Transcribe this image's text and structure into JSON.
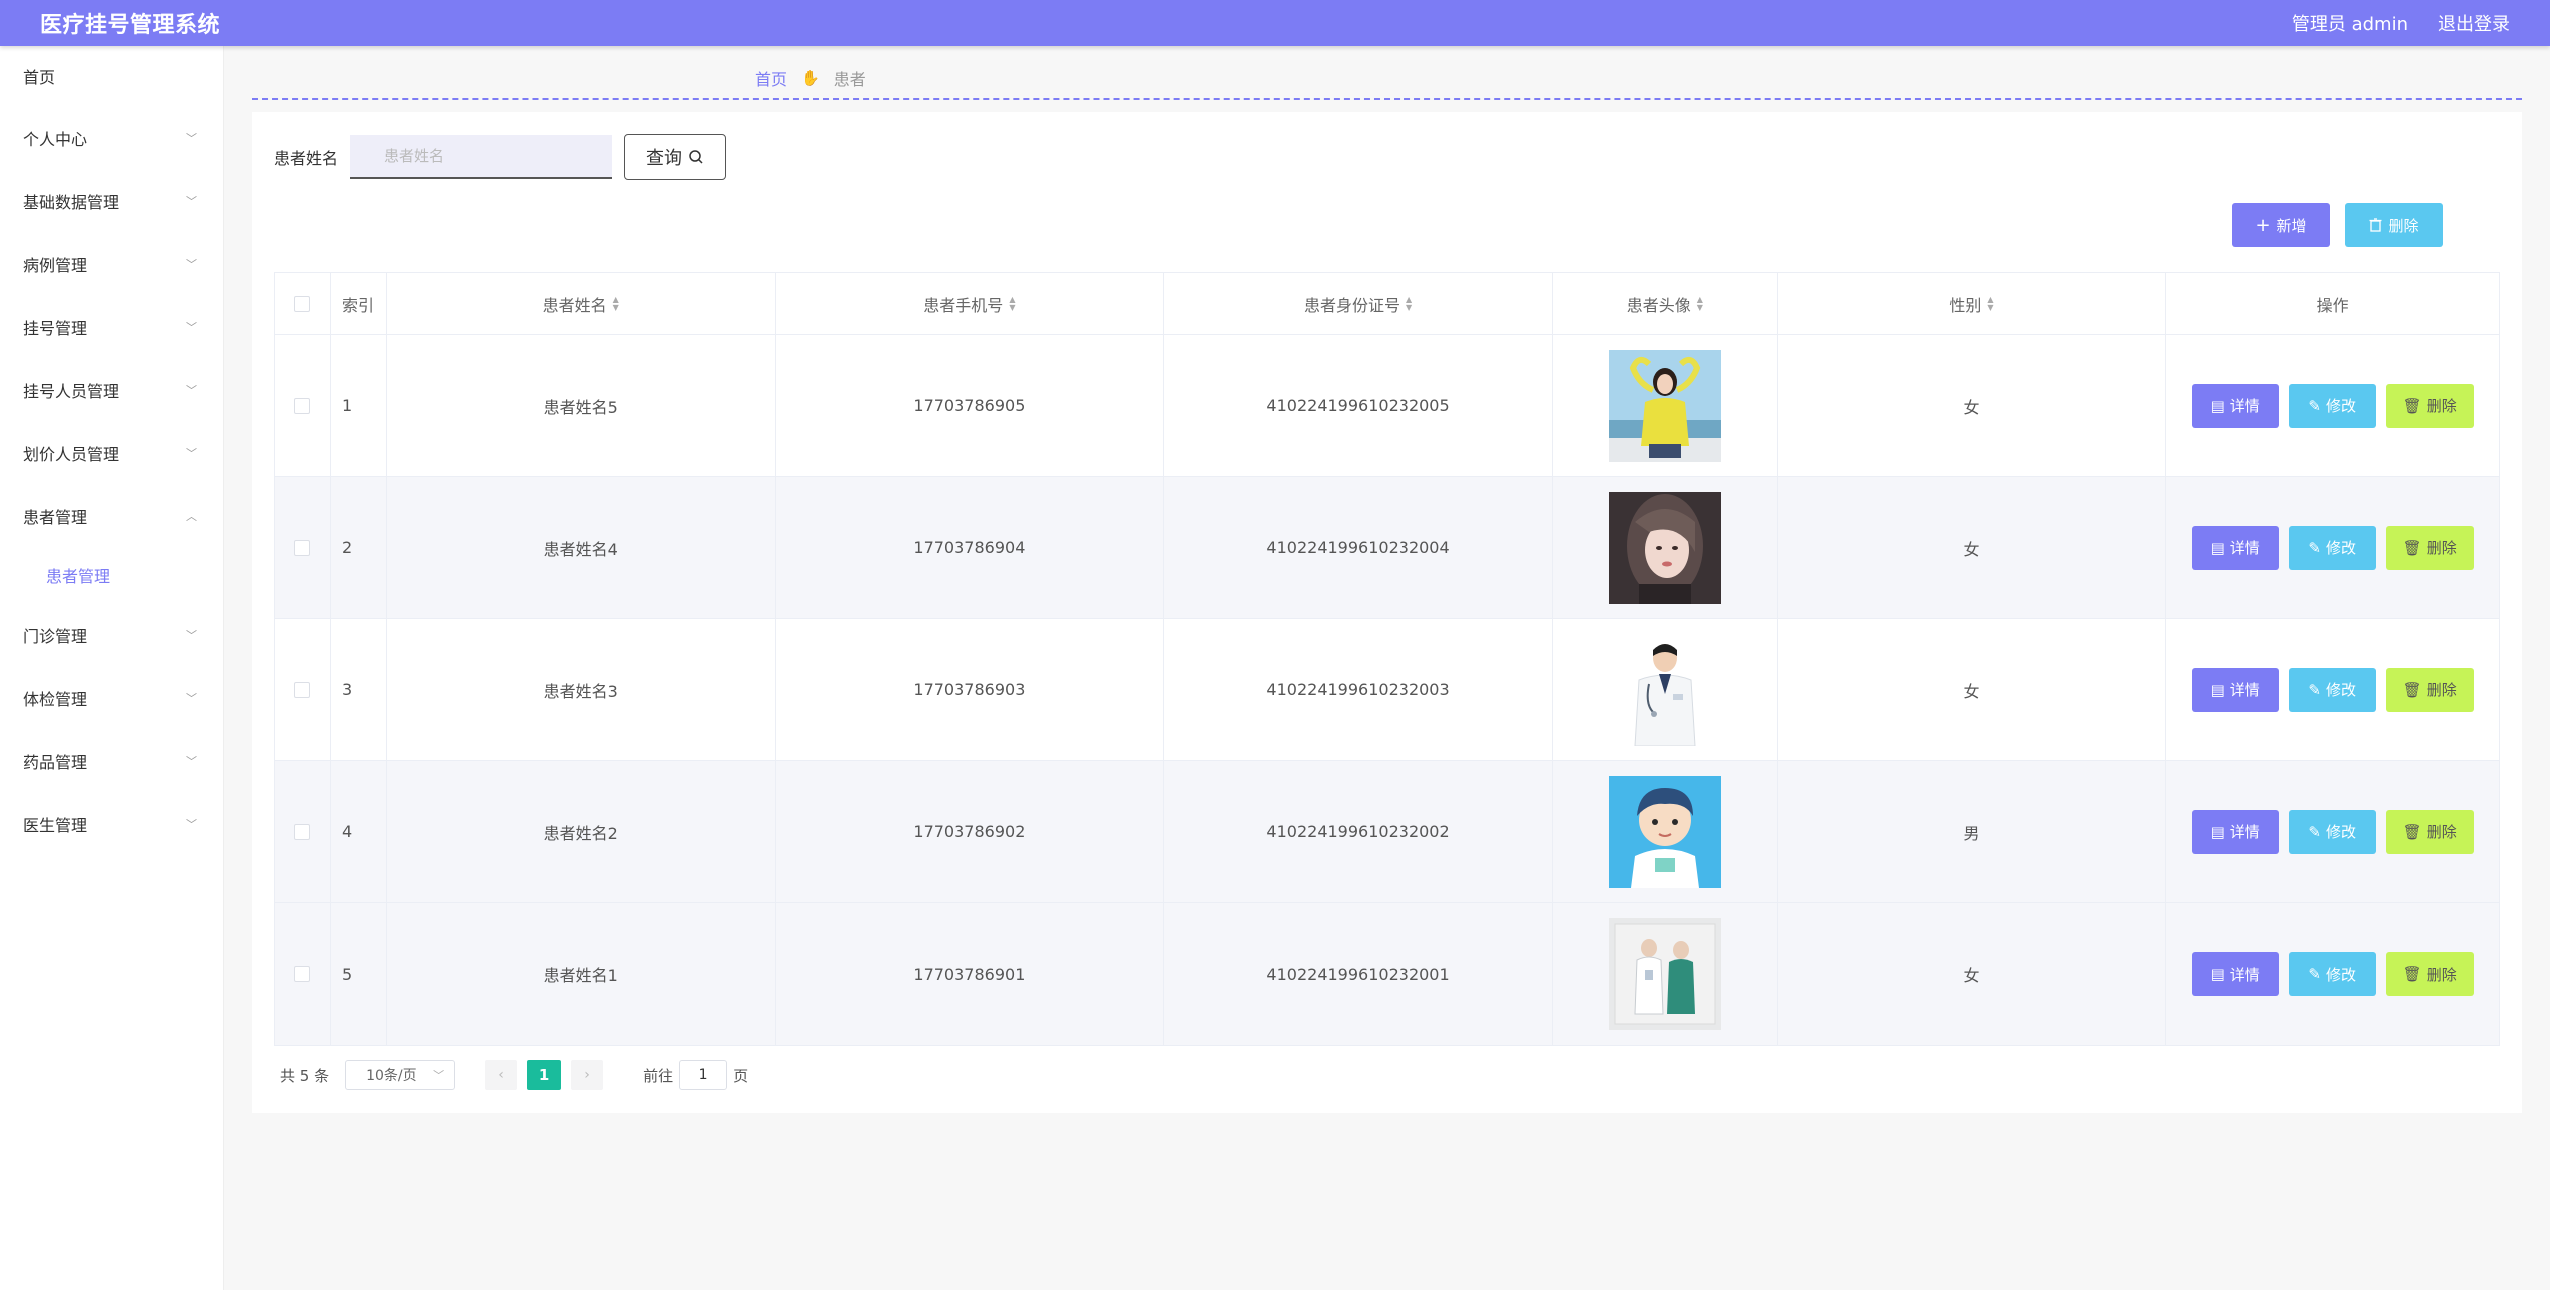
{
  "header": {
    "title": "医疗挂号管理系统",
    "user": "管理员 admin",
    "logout": "退出登录"
  },
  "sidebar": {
    "home": "首页",
    "items": [
      {
        "label": "个人中心"
      },
      {
        "label": "基础数据管理"
      },
      {
        "label": "病例管理"
      },
      {
        "label": "挂号管理"
      },
      {
        "label": "挂号人员管理"
      },
      {
        "label": "划价人员管理"
      },
      {
        "label": "患者管理"
      },
      {
        "label": "门诊管理"
      },
      {
        "label": "体检管理"
      },
      {
        "label": "药品管理"
      },
      {
        "label": "医生管理"
      }
    ],
    "active_sub": "患者管理"
  },
  "breadcrumb": {
    "home": "首页",
    "current": "患者"
  },
  "search": {
    "label": "患者姓名",
    "placeholder": "患者姓名",
    "value": "",
    "button": "查询"
  },
  "toolbar": {
    "add": "新增",
    "delete": "删除"
  },
  "table": {
    "columns": {
      "index": "索引",
      "name": "患者姓名",
      "phone": "患者手机号",
      "id_card": "患者身份证号",
      "avatar": "患者头像",
      "gender": "性别",
      "ops": "操作"
    },
    "ops": {
      "detail": "详情",
      "edit": "修改",
      "delete": "删除"
    },
    "rows": [
      {
        "index": "1",
        "name": "患者姓名5",
        "phone": "17703786905",
        "id_card": "410224199610232005",
        "gender": "女",
        "avatar": "woman-yellow-sweater-beach"
      },
      {
        "index": "2",
        "name": "患者姓名4",
        "phone": "17703786904",
        "id_card": "410224199610232004",
        "gender": "女",
        "avatar": "woman-portrait-dark"
      },
      {
        "index": "3",
        "name": "患者姓名3",
        "phone": "17703786903",
        "id_card": "410224199610232003",
        "gender": "女",
        "avatar": "doctor-white-coat"
      },
      {
        "index": "4",
        "name": "患者姓名2",
        "phone": "17703786902",
        "id_card": "410224199610232002",
        "gender": "男",
        "avatar": "cartoon-doctor-blue"
      },
      {
        "index": "5",
        "name": "患者姓名1",
        "phone": "17703786901",
        "id_card": "410224199610232001",
        "gender": "女",
        "avatar": "medical-staff-illustration"
      }
    ]
  },
  "pagination": {
    "total": "共 5 条",
    "page_size": "10条/页",
    "current": "1",
    "goto_label": "前往",
    "goto_value": "1",
    "goto_suffix": "页"
  },
  "colors": {
    "primary": "#7c7cf4",
    "info": "#5ac8f0",
    "lime": "#c6f357",
    "page_active": "#1abc9c"
  }
}
